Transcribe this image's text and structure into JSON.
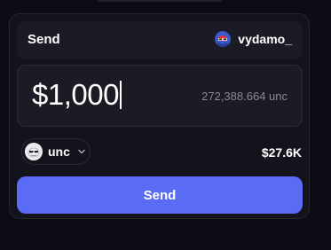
{
  "header": {
    "title": "Send",
    "username": "vydamo_",
    "avatar_icon": "user-avatar"
  },
  "amount": {
    "value": "$1,000",
    "converted": "272,388.664 unc"
  },
  "token": {
    "symbol": "unc",
    "icon": "token-logo"
  },
  "balance": {
    "value": "$27.6K"
  },
  "actions": {
    "send_label": "Send"
  },
  "colors": {
    "background": "#0c0c14",
    "card": "#13131c",
    "panel": "#1b1b25",
    "accent": "#5a6cf6",
    "muted_text": "#8a8a98"
  }
}
